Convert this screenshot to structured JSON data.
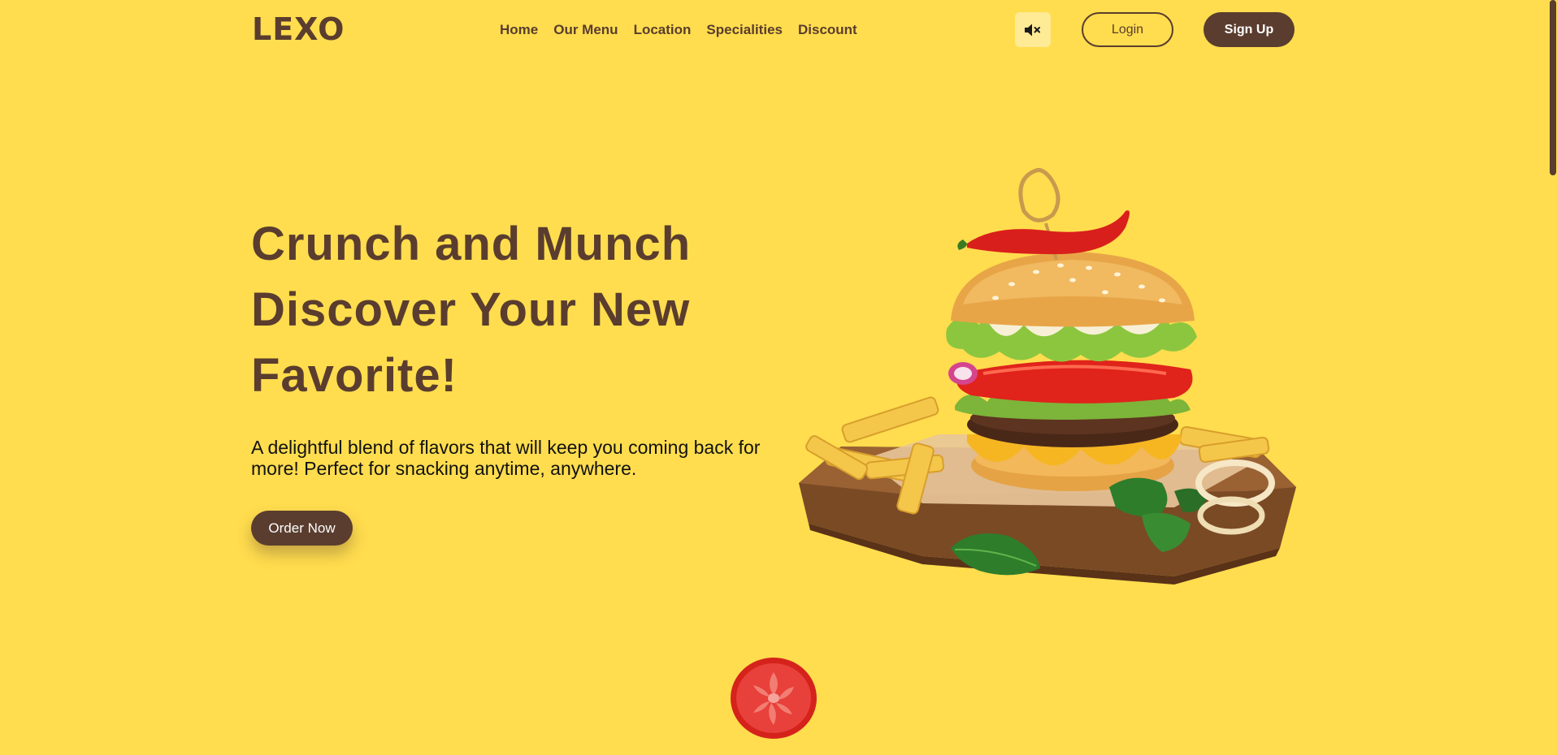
{
  "header": {
    "logo": "LEXO",
    "nav": [
      "Home",
      "Our Menu",
      "Location",
      "Specialities",
      "Discount"
    ],
    "mute_icon": "speaker-muted-icon",
    "login_label": "Login",
    "signup_label": "Sign Up"
  },
  "hero": {
    "title_lines": [
      "Crunch and Munch",
      "Discover Your New",
      "Favorite!"
    ],
    "description": "A delightful blend of flavors that will keep you coming back for more! Perfect for snacking anytime, anywhere.",
    "order_label": "Order Now"
  },
  "colors": {
    "background": "#FFDD4E",
    "brand_brown": "#5A3D2E",
    "mute_button_bg": "#FFEA96"
  }
}
